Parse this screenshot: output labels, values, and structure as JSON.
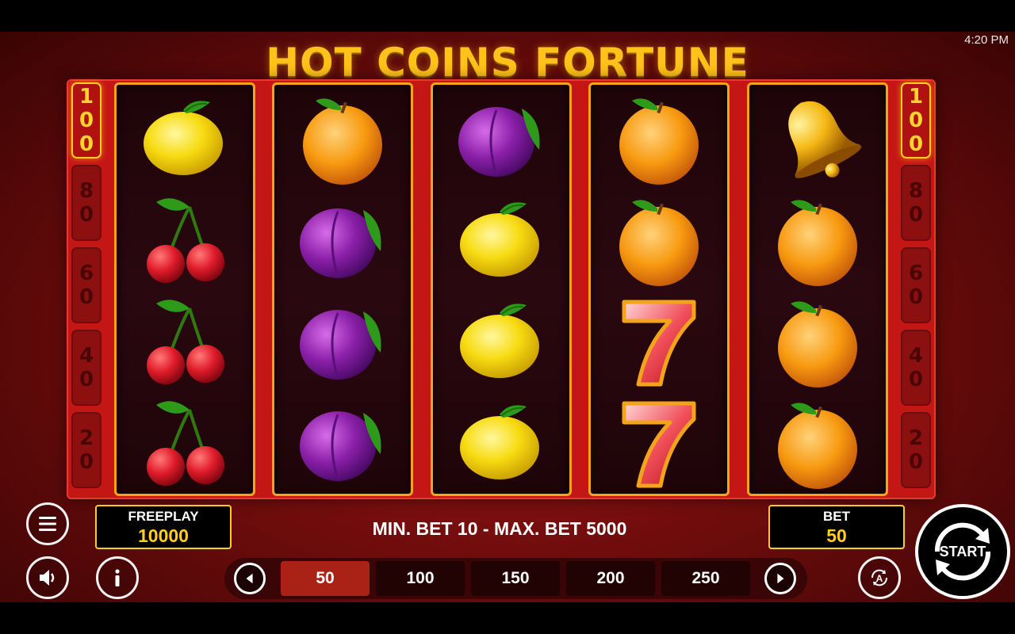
{
  "status_bar": {
    "time": "4:20 PM"
  },
  "title": "HOT COINS FORTUNE",
  "ladder_left": [
    "100",
    "80",
    "60",
    "40",
    "20"
  ],
  "ladder_right": [
    "100",
    "80",
    "60",
    "40",
    "20"
  ],
  "reels": [
    [
      "lemon",
      "cherries",
      "cherries",
      "cherries"
    ],
    [
      "orange",
      "plum",
      "plum",
      "plum"
    ],
    [
      "plum",
      "lemon",
      "lemon",
      "lemon"
    ],
    [
      "orange",
      "orange",
      "seven",
      "seven"
    ],
    [
      "bell",
      "orange",
      "orange",
      "orange"
    ]
  ],
  "freeplay": {
    "label": "FREEPLAY",
    "value": "10000"
  },
  "bet_limits": "MIN. BET 10 - MAX. BET 5000",
  "bet": {
    "label": "BET",
    "value": "50"
  },
  "bet_options": [
    "50",
    "100",
    "150",
    "200",
    "250"
  ],
  "selected_bet": "50",
  "start_label": "START",
  "icons": {
    "menu": "hamburger-menu-icon",
    "sound": "speaker-icon",
    "info": "info-icon",
    "auto": "autoplay-icon",
    "prev": "chevron-left-icon",
    "next": "chevron-right-icon",
    "start": "refresh-arrows-icon"
  },
  "colors": {
    "gold": "#ffce1e",
    "reel_border": "#f4a418",
    "frame_red": "#c51616",
    "selected_bet": "#a92215"
  }
}
